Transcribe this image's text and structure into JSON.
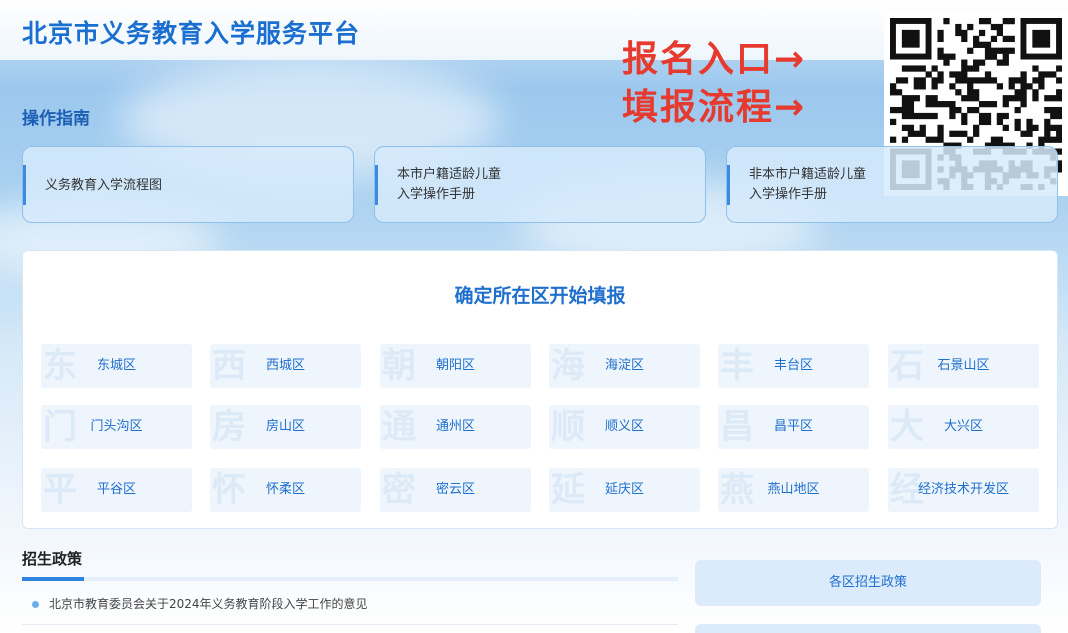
{
  "header": {
    "title": "北京市义务教育入学服务平台"
  },
  "promo": {
    "line1": "报名入口→",
    "line2": "填报流程→"
  },
  "qr": {
    "icon": "qr-code-icon"
  },
  "guide": {
    "title": "操作指南",
    "cards": [
      {
        "line1": "义务教育入学流程图",
        "line2": ""
      },
      {
        "line1": "本市户籍适龄儿童",
        "line2": "入学操作手册"
      },
      {
        "line1": "非本市户籍适龄儿童",
        "line2": "入学操作手册"
      }
    ]
  },
  "districts": {
    "title": "确定所在区开始填报",
    "items": [
      {
        "label": "东城区",
        "ghost": "东"
      },
      {
        "label": "西城区",
        "ghost": "西"
      },
      {
        "label": "朝阳区",
        "ghost": "朝"
      },
      {
        "label": "海淀区",
        "ghost": "海"
      },
      {
        "label": "丰台区",
        "ghost": "丰"
      },
      {
        "label": "石景山区",
        "ghost": "石"
      },
      {
        "label": "门头沟区",
        "ghost": "门"
      },
      {
        "label": "房山区",
        "ghost": "房"
      },
      {
        "label": "通州区",
        "ghost": "通"
      },
      {
        "label": "顺义区",
        "ghost": "顺"
      },
      {
        "label": "昌平区",
        "ghost": "昌"
      },
      {
        "label": "大兴区",
        "ghost": "大"
      },
      {
        "label": "平谷区",
        "ghost": "平"
      },
      {
        "label": "怀柔区",
        "ghost": "怀"
      },
      {
        "label": "密云区",
        "ghost": "密"
      },
      {
        "label": "延庆区",
        "ghost": "延"
      },
      {
        "label": "燕山地区",
        "ghost": "燕"
      },
      {
        "label": "经济技术开发区",
        "ghost": "经"
      }
    ]
  },
  "policy": {
    "title": "招生政策",
    "news": [
      "北京市教育委员会关于2024年义务教育阶段入学工作的意见"
    ],
    "side_button": "各区招生政策"
  },
  "colors": {
    "brand_blue": "#1a6fd0",
    "promo_red": "#e63a2e"
  }
}
